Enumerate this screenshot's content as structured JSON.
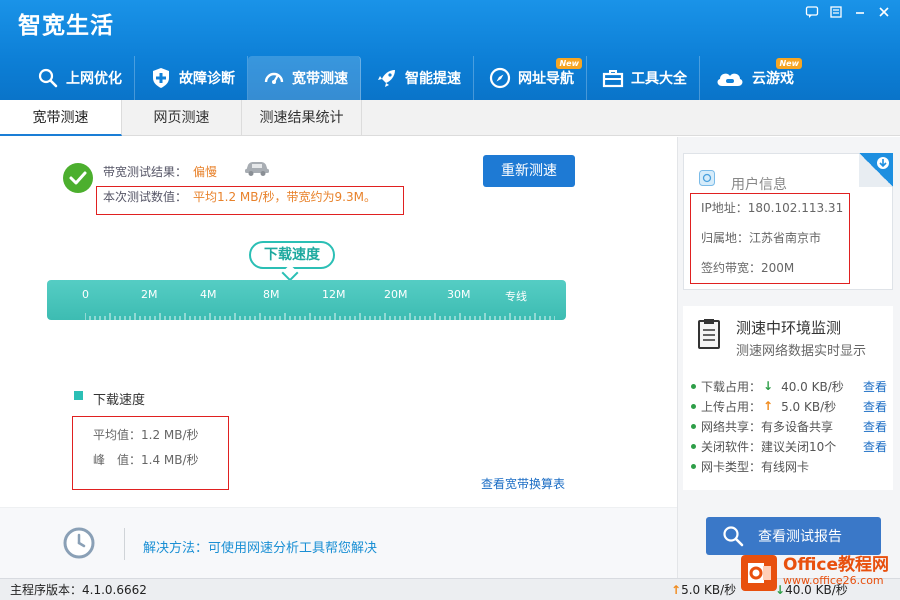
{
  "app": {
    "title": "智宽生活"
  },
  "window_controls": [
    "message-icon",
    "menu-icon",
    "minimize-icon",
    "close-icon"
  ],
  "nav": {
    "items": [
      {
        "label": "上网优化",
        "icon": "search-icon",
        "new": false
      },
      {
        "label": "故障诊断",
        "icon": "shield-plus-icon",
        "new": false
      },
      {
        "label": "宽带测速",
        "icon": "speed-gauge-icon",
        "new": false,
        "active": true
      },
      {
        "label": "智能提速",
        "icon": "rocket-icon",
        "new": false
      },
      {
        "label": "网址导航",
        "icon": "compass-icon",
        "new": true
      },
      {
        "label": "工具大全",
        "icon": "toolbox-icon",
        "new": false
      },
      {
        "label": "云游戏",
        "icon": "cloud-game-icon",
        "new": true
      }
    ],
    "new_badge": "New"
  },
  "subtabs": {
    "items": [
      "宽带测速",
      "网页测速",
      "测速结果统计"
    ],
    "active": 0
  },
  "result": {
    "label": "带宽测试结果：",
    "value": "偏慢",
    "measure_label": "本次测试数值：",
    "measure_value": "平均1.2 MB/秒，带宽约为9.3M。",
    "retest_button": "重新测速"
  },
  "speed_meter": {
    "bubble": "下载速度",
    "scale": [
      "0",
      "2M",
      "4M",
      "8M",
      "12M",
      "20M",
      "30M",
      "专线"
    ]
  },
  "stats": {
    "legend": "下载速度",
    "avg": "平均值：1.2 MB/秒",
    "peak": "峰　值：1.4 MB/秒",
    "table_link": "查看宽带换算表"
  },
  "solution": {
    "text": "解决方法：可使用网速分析工具帮您解决"
  },
  "user_info": {
    "title": "用户信息",
    "ip": "IP地址：180.102.113.31",
    "location": "归属地：江苏省南京市",
    "bandwidth": "签约带宽：200M"
  },
  "env": {
    "title": "测速中环境监测",
    "subtitle": "测速网络数据实时显示",
    "rows": [
      {
        "label": "下载占用：",
        "arrow": "down",
        "value": "40.0 KB/秒",
        "link": "查看"
      },
      {
        "label": "上传占用：",
        "arrow": "up",
        "value": "5.0 KB/秒",
        "link": "查看"
      },
      {
        "label": "网络共享：有多设备共享",
        "arrow": "",
        "value": "",
        "link": "查看"
      },
      {
        "label": "关闭软件：建议关闭10个",
        "arrow": "",
        "value": "",
        "link": "查看"
      },
      {
        "label": "网卡类型：有线网卡",
        "arrow": "",
        "value": "",
        "link": ""
      }
    ]
  },
  "report_button": "查看测试报告",
  "status": {
    "version": "主程序版本：4.1.0.6662",
    "up": "5.0 KB/秒",
    "down": "40.0 KB/秒"
  },
  "watermark": {
    "main": "Office教程网",
    "sub": "www.office26.com"
  },
  "colors": {
    "header": "#1a93e8",
    "accent": "#1e7ad4",
    "teal": "#2bbfb5",
    "warning": "#e8822b",
    "ok": "#4caf2e"
  }
}
